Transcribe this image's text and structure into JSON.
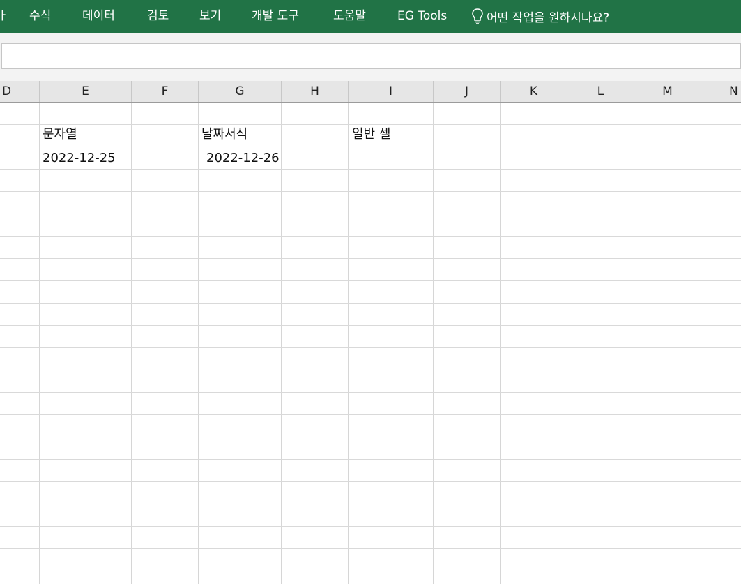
{
  "ribbon": {
    "tabs": [
      {
        "id": "cut",
        "label": "ㅏ"
      },
      {
        "id": "formulas",
        "label": "수식"
      },
      {
        "id": "data",
        "label": "데이터"
      },
      {
        "id": "review",
        "label": "검토"
      },
      {
        "id": "view",
        "label": "보기"
      },
      {
        "id": "developer",
        "label": "개발 도구"
      },
      {
        "id": "help",
        "label": "도움말"
      },
      {
        "id": "egtools",
        "label": "EG Tools"
      }
    ],
    "tell_me": "어떤 작업을 원하시나요?",
    "tell_me_icon": "lightbulb-icon",
    "color": "#217346"
  },
  "formula_bar": {
    "value": ""
  },
  "columns": [
    "D",
    "E",
    "F",
    "G",
    "H",
    "I",
    "J",
    "K",
    "L",
    "M",
    "N"
  ],
  "cells": {
    "E2": "문자열",
    "G2": "날짜서식",
    "I2": "일반 셀",
    "E3": "2022-12-25",
    "G3": "2022-12-26"
  }
}
